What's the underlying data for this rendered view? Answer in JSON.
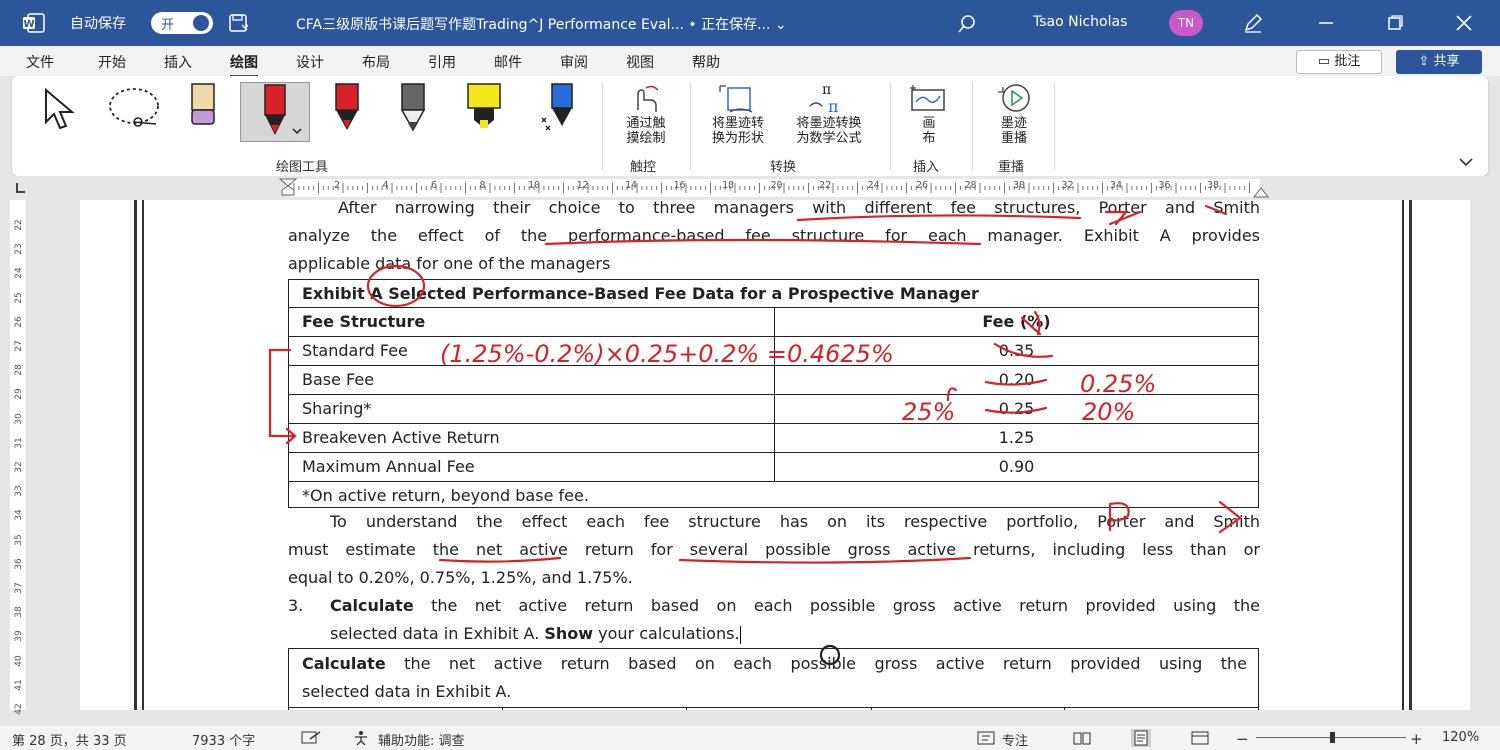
{
  "titlebar": {
    "autosave_label": "自动保存",
    "autosave_state": "开",
    "doc_title": "CFA三级原版书课后题写作题Trading^J Performance Eval... • 正在保存... ⌄",
    "user_name": "Tsao Nicholas",
    "user_initials": "TN"
  },
  "menu": {
    "tabs": [
      "文件",
      "开始",
      "插入",
      "绘图",
      "设计",
      "布局",
      "引用",
      "邮件",
      "审阅",
      "视图",
      "帮助"
    ],
    "active": "绘图",
    "comment_label": "批注",
    "share_label": "共享"
  },
  "ribbon": {
    "group_draw_tools": "绘图工具",
    "touch_draw": "通过触摸绘制",
    "touch_draw_l1": "通过触",
    "touch_draw_l2": "摸绘制",
    "group_touch": "触控",
    "ink_to_shape_l1": "将墨迹转",
    "ink_to_shape_l2": "换为形状",
    "ink_to_math_l1": "将墨迹转换",
    "ink_to_math_l2": "为数学公式",
    "group_convert": "转换",
    "canvas_l1": "画",
    "canvas_l2": "布",
    "group_insert": "插入",
    "replay_l1": "墨迹",
    "replay_l2": "重播",
    "group_replay": "重播",
    "colors": {
      "red": "#d8222a",
      "yellow": "#f4e81a",
      "blue": "#2b6dd6",
      "accent": "#2b579a"
    }
  },
  "ruler": {
    "top_numbers": [
      "2",
      "4",
      "6",
      "8",
      "10",
      "12",
      "14",
      "16",
      "18",
      "20",
      "22",
      "24",
      "26",
      "28",
      "30",
      "32",
      "34",
      "36",
      "38"
    ],
    "left_numbers": [
      "22",
      "23",
      "24",
      "25",
      "26",
      "27",
      "28",
      "29",
      "30",
      "31",
      "32",
      "33",
      "34",
      "35",
      "36",
      "37",
      "38",
      "39",
      "40",
      "41",
      "42"
    ]
  },
  "doc": {
    "p1_line1": "After narrowing their choice to three managers with different fee structures, Porter and Smith",
    "p1_line2": "analyze the effect of the performance-based fee structure for each manager. Exhibit A provides",
    "p1_line3": "applicable data for one of the managers",
    "table_title": "Exhibit A Selected Performance-Based Fee Data for a Prospective Manager",
    "col_structure": "Fee Structure",
    "col_fee": "Fee (%)",
    "rows": [
      {
        "label": "Standard Fee",
        "value": "0.35"
      },
      {
        "label": "Base Fee",
        "value": "0.20"
      },
      {
        "label": "Sharing*",
        "value": "0.25"
      },
      {
        "label": "Breakeven Active Return",
        "value": "1.25"
      },
      {
        "label": "Maximum Annual Fee",
        "value": "0.90"
      }
    ],
    "footnote": "*On active return, beyond base fee.",
    "p2_line1": "To understand the effect each fee structure has on its respective portfolio, Porter and Smith",
    "p2_line2": "must estimate the net active return for several possible gross active returns, including less than or",
    "p2_line3": "equal to 0.20%, 0.75%, 1.25%, and 1.75%.",
    "q_number": "3.",
    "q_bold1": "Calculate",
    "q_text1": " the net active return based on each possible gross active return provided using the",
    "q_text2a": "selected data in Exhibit A. ",
    "q_bold2": "Show",
    "q_text2b": " your calculations.",
    "box_bold": "Calculate",
    "box_text1": " the net active return based on each possible gross active return provided using the",
    "box_text2": "selected data in Exhibit A."
  },
  "ink": {
    "formula": "(1.25%-0.2%)×0.25+0.2% =0.4625%",
    "note1": "0.25%",
    "note2": "25%",
    "note3": "20%"
  },
  "status": {
    "page_info": "第 28 页，共 33 页",
    "word_count": "7933 个字",
    "accessibility": "辅助功能: 调查",
    "focus": "专注",
    "zoom": "120%"
  }
}
